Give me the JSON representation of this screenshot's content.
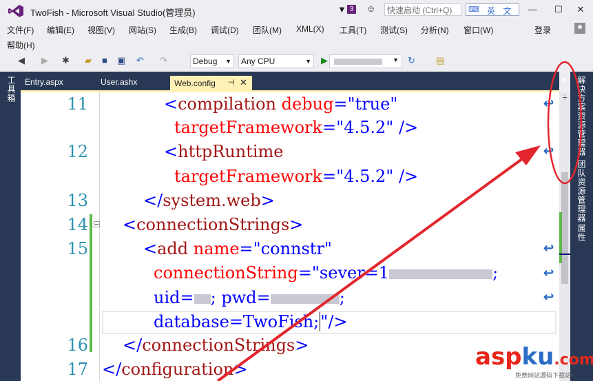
{
  "window": {
    "title": "TwoFish - Microsoft Visual Studio(管理员)",
    "notification_count": "3",
    "quick_launch_placeholder": "快速启动 (Ctrl+Q)",
    "ime_mode": "英 文",
    "minimize_glyph": "—",
    "maximize_glyph": "☐",
    "close_glyph": "✕"
  },
  "menu": {
    "items": [
      "文件(F)",
      "编辑(E)",
      "视图(V)",
      "网站(S)",
      "生成(B)",
      "调试(D)",
      "团队(M)",
      "XML(X)",
      "工具(T)",
      "测试(S)",
      "分析(N)",
      "窗口(W)",
      "帮助(H)"
    ],
    "sign_in": "登录"
  },
  "toolbar": {
    "configuration": "Debug",
    "platform": "Any CPU"
  },
  "left_dock": {
    "toolbox_label": "工具箱"
  },
  "tabs": [
    {
      "label": "Entry.aspx",
      "active": false
    },
    {
      "label": "User.ashx",
      "active": false
    },
    {
      "label": "Web.config",
      "active": true
    }
  ],
  "editor": {
    "line_numbers": {
      "l11": "11",
      "l12": "12",
      "l13": "13",
      "l14": "14",
      "l15": "15",
      "l16": "16",
      "l17": "17"
    },
    "code": {
      "compilation_tag": "compilation",
      "debug_attr": "debug",
      "debug_value": "\"true\"",
      "target_attr": "targetFramework",
      "target_value": "\"4.5.2\"",
      "http_runtime_tag": "httpRuntime",
      "system_web_tag": "system.web",
      "connection_strings_tag": "connectionStrings",
      "add_tag": "add",
      "name_attr": "name",
      "name_value": "\"connstr\"",
      "connstring_attr": "connectionString",
      "connstring_value_start": "\"sever=1",
      "connstring_value_end": ";",
      "uid_text": "uid=",
      "pwd_text": "; pwd=",
      "pwd_end": ";",
      "database_text": "database=TwoFish;",
      "database_close": "\"",
      "configuration_tag": "configuration"
    }
  },
  "right_dock": {
    "solution_explorer": "解决方案资源管理器",
    "team_explorer": "团队资源管理器",
    "properties": "属性"
  },
  "watermark": {
    "brand_a": "asp",
    "brand_b": "ku",
    "brand_c": ".com",
    "tagline": "免费网站源码下载站!"
  },
  "colors": {
    "vs_purple": "#68217a",
    "dock_navy": "#293955",
    "active_tab": "#fff1b5",
    "annotation_red": "#e3262e",
    "xml_tag": "#a31515",
    "xml_attr": "#ff0000",
    "xml_value": "#0000ff",
    "line_number": "#2b91af",
    "change_bar": "#5eb84a"
  },
  "icons": [
    "vs-logo-icon",
    "filter-icon",
    "feedback-icon",
    "back-icon",
    "forward-icon",
    "new-project-icon",
    "open-file-icon",
    "save-icon",
    "save-all-icon",
    "undo-icon",
    "redo-icon",
    "start-icon",
    "refresh-icon",
    "browse-icon",
    "pin-icon",
    "close-icon",
    "word-wrap-icon",
    "split-icon"
  ]
}
